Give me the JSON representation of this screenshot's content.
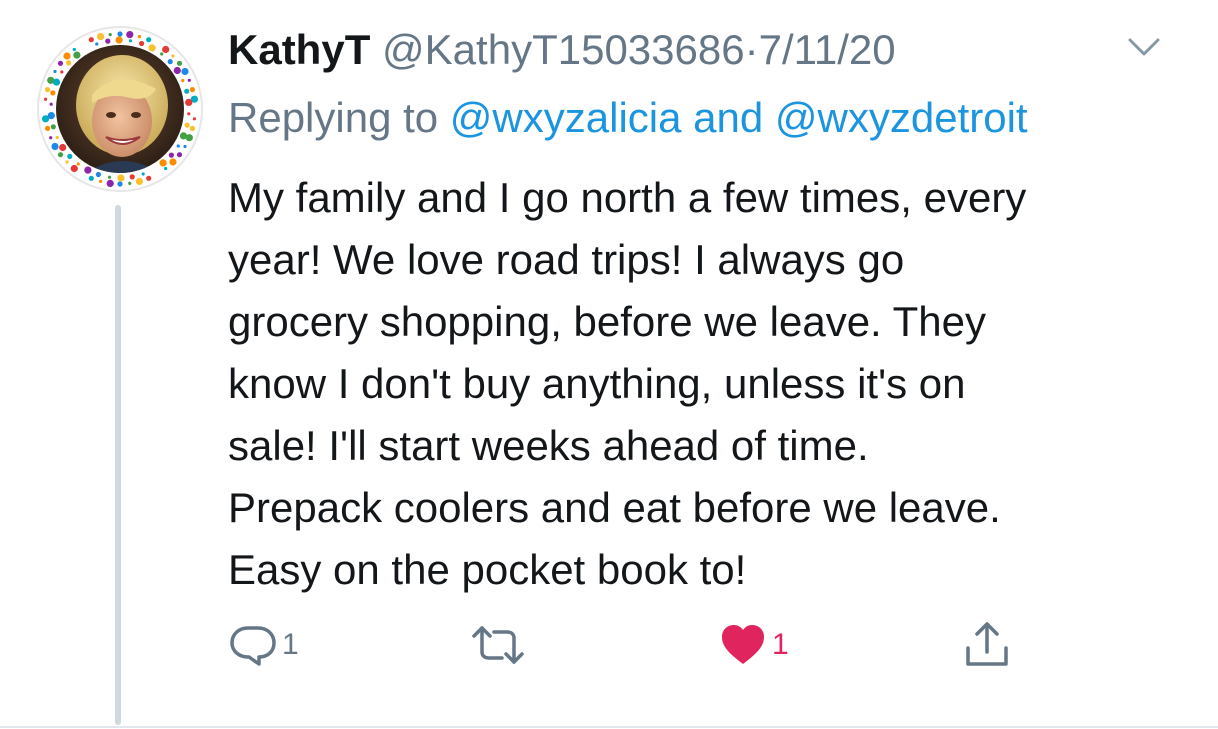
{
  "tweet": {
    "display_name": "KathyT",
    "handle": "@KathyT15033686",
    "separator": "·",
    "date": "7/11/20",
    "replying_prefix": "Replying to",
    "reply_mention_1": "@wxyzalicia",
    "reply_conjunction": "and",
    "reply_mention_2": "@wxyzdetroit",
    "text": "My family and I go north a few times, every\nyear! We love road trips! I always go\ngrocery shopping, before we leave. They\nknow I don't buy anything, unless it's on\nsale! I'll start weeks ahead of time.\nPrepack coolers and eat before we leave.\nEasy on the pocket book to!"
  },
  "actions": {
    "reply_count": "1",
    "retweet_count": "",
    "like_count": "1",
    "liked": true
  },
  "icons": {
    "menu": "chevron-down-icon",
    "reply": "reply-bubble-icon",
    "retweet": "retweet-icon",
    "like": "heart-icon",
    "share": "share-icon"
  },
  "colors": {
    "name": "#14171a",
    "secondary": "#657786",
    "mention": "#1b95e0",
    "like": "#e0245e",
    "thread_line": "#cfd9de"
  }
}
